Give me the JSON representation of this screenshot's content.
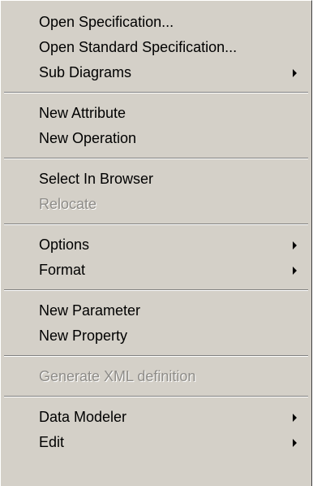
{
  "menu": {
    "groups": [
      [
        {
          "label": "Open Specification...",
          "enabled": true,
          "submenu": false
        },
        {
          "label": "Open Standard Specification...",
          "enabled": true,
          "submenu": false
        },
        {
          "label": "Sub Diagrams",
          "enabled": true,
          "submenu": true
        }
      ],
      [
        {
          "label": "New Attribute",
          "enabled": true,
          "submenu": false
        },
        {
          "label": "New Operation",
          "enabled": true,
          "submenu": false
        }
      ],
      [
        {
          "label": "Select In Browser",
          "enabled": true,
          "submenu": false
        },
        {
          "label": "Relocate",
          "enabled": false,
          "submenu": false
        }
      ],
      [
        {
          "label": "Options",
          "enabled": true,
          "submenu": true
        },
        {
          "label": "Format",
          "enabled": true,
          "submenu": true
        }
      ],
      [
        {
          "label": "New Parameter",
          "enabled": true,
          "submenu": false
        },
        {
          "label": "New Property",
          "enabled": true,
          "submenu": false
        }
      ],
      [
        {
          "label": "Generate XML definition",
          "enabled": false,
          "submenu": false
        }
      ],
      [
        {
          "label": "Data Modeler",
          "enabled": true,
          "submenu": true
        },
        {
          "label": "Edit",
          "enabled": true,
          "submenu": true
        }
      ]
    ]
  }
}
